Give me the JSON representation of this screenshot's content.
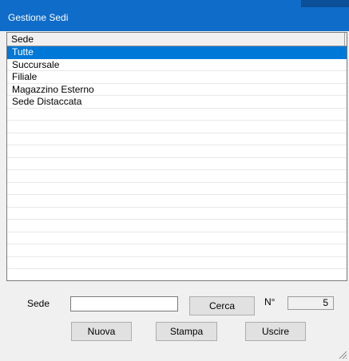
{
  "window": {
    "title": "Gestione Sedi"
  },
  "list": {
    "column_header": "Sede",
    "items": [
      "Tutte",
      "Succursale",
      "Filiale",
      "Magazzino Esterno",
      "Sede Distaccata"
    ],
    "selected_index": 0
  },
  "search": {
    "label": "Sede",
    "value": "",
    "button_label": "Cerca"
  },
  "count": {
    "label": "N°",
    "value": "5"
  },
  "buttons": {
    "new_label": "Nuova",
    "print_label": "Stampa",
    "exit_label": "Uscire"
  },
  "colors": {
    "titlebar": "#0f6cc9",
    "selection": "#0078d7"
  }
}
